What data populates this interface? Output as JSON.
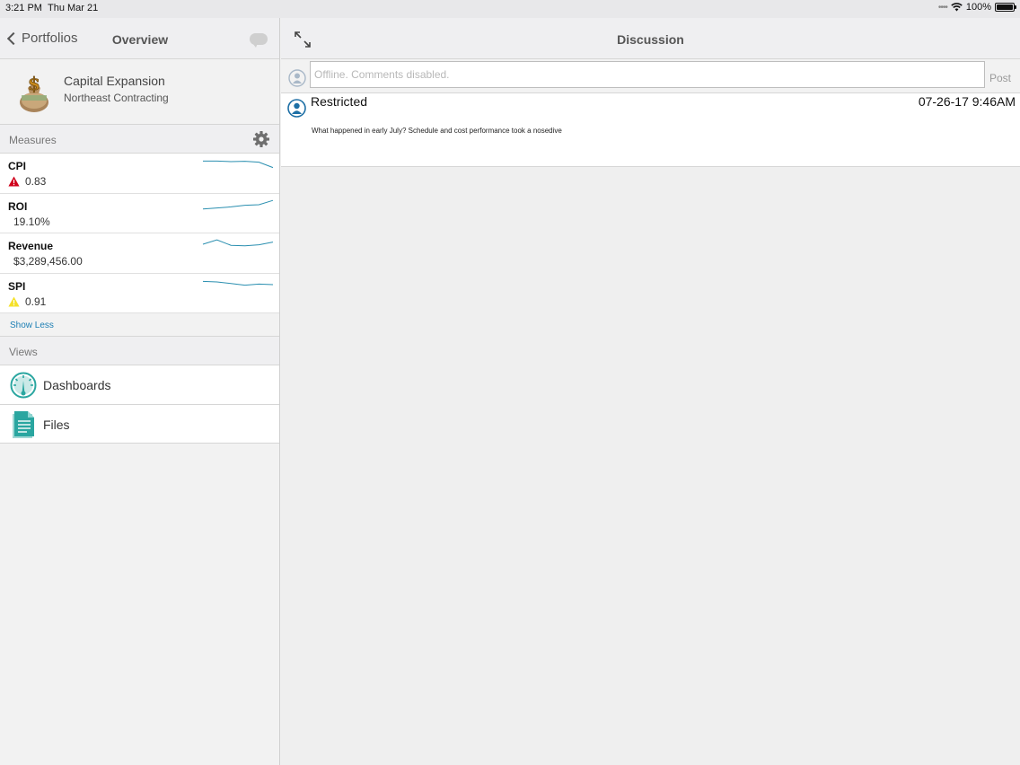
{
  "status_bar": {
    "time": "3:21 PM",
    "date": "Thu Mar 21",
    "battery": "100%",
    "battery_level": 1.0
  },
  "left_nav": {
    "back_label": "Portfolios",
    "title": "Overview"
  },
  "project": {
    "name": "Capital Expansion",
    "organization": "Northeast Contracting",
    "logo_icon": "money-bag-icon"
  },
  "measures_section": {
    "header": "Measures",
    "items": [
      {
        "name": "CPI",
        "value": "0.83",
        "status_icon": "alert-red-icon",
        "status_color": "#d0021b",
        "trend": [
          0.8,
          0.8,
          0.75,
          0.78,
          0.7,
          0.2
        ]
      },
      {
        "name": "ROI",
        "value": "19.10%",
        "status_icon": "",
        "status_color": "",
        "trend": [
          0.1,
          0.2,
          0.3,
          0.45,
          0.5,
          0.9
        ]
      },
      {
        "name": "Revenue",
        "value": "$3,289,456.00",
        "status_icon": "",
        "status_color": "",
        "trend": [
          0.5,
          0.9,
          0.4,
          0.35,
          0.45,
          0.7
        ]
      },
      {
        "name": "SPI",
        "value": "0.91",
        "status_icon": "alert-yellow-icon",
        "status_color": "#f8e71c",
        "trend": [
          0.8,
          0.75,
          0.6,
          0.45,
          0.55,
          0.5
        ]
      }
    ],
    "toggle_label": "Show Less"
  },
  "views_section": {
    "header": "Views",
    "items": [
      {
        "label": "Dashboards",
        "icon": "dashboard-gauge-icon"
      },
      {
        "label": "Files",
        "icon": "document-icon"
      }
    ]
  },
  "right_nav": {
    "title": "Discussion"
  },
  "comment_box": {
    "placeholder": "Offline. Comments disabled.",
    "post_label": "Post"
  },
  "posts": [
    {
      "author": "Restricted",
      "timestamp": "07-26-17 9:46AM",
      "body": "What happened in early July? Schedule and cost performance took a nosedive"
    }
  ],
  "colors": {
    "accent": "#1d7fb4",
    "teal": "#2aa6a0",
    "sparkline": "#2a8fb0"
  }
}
